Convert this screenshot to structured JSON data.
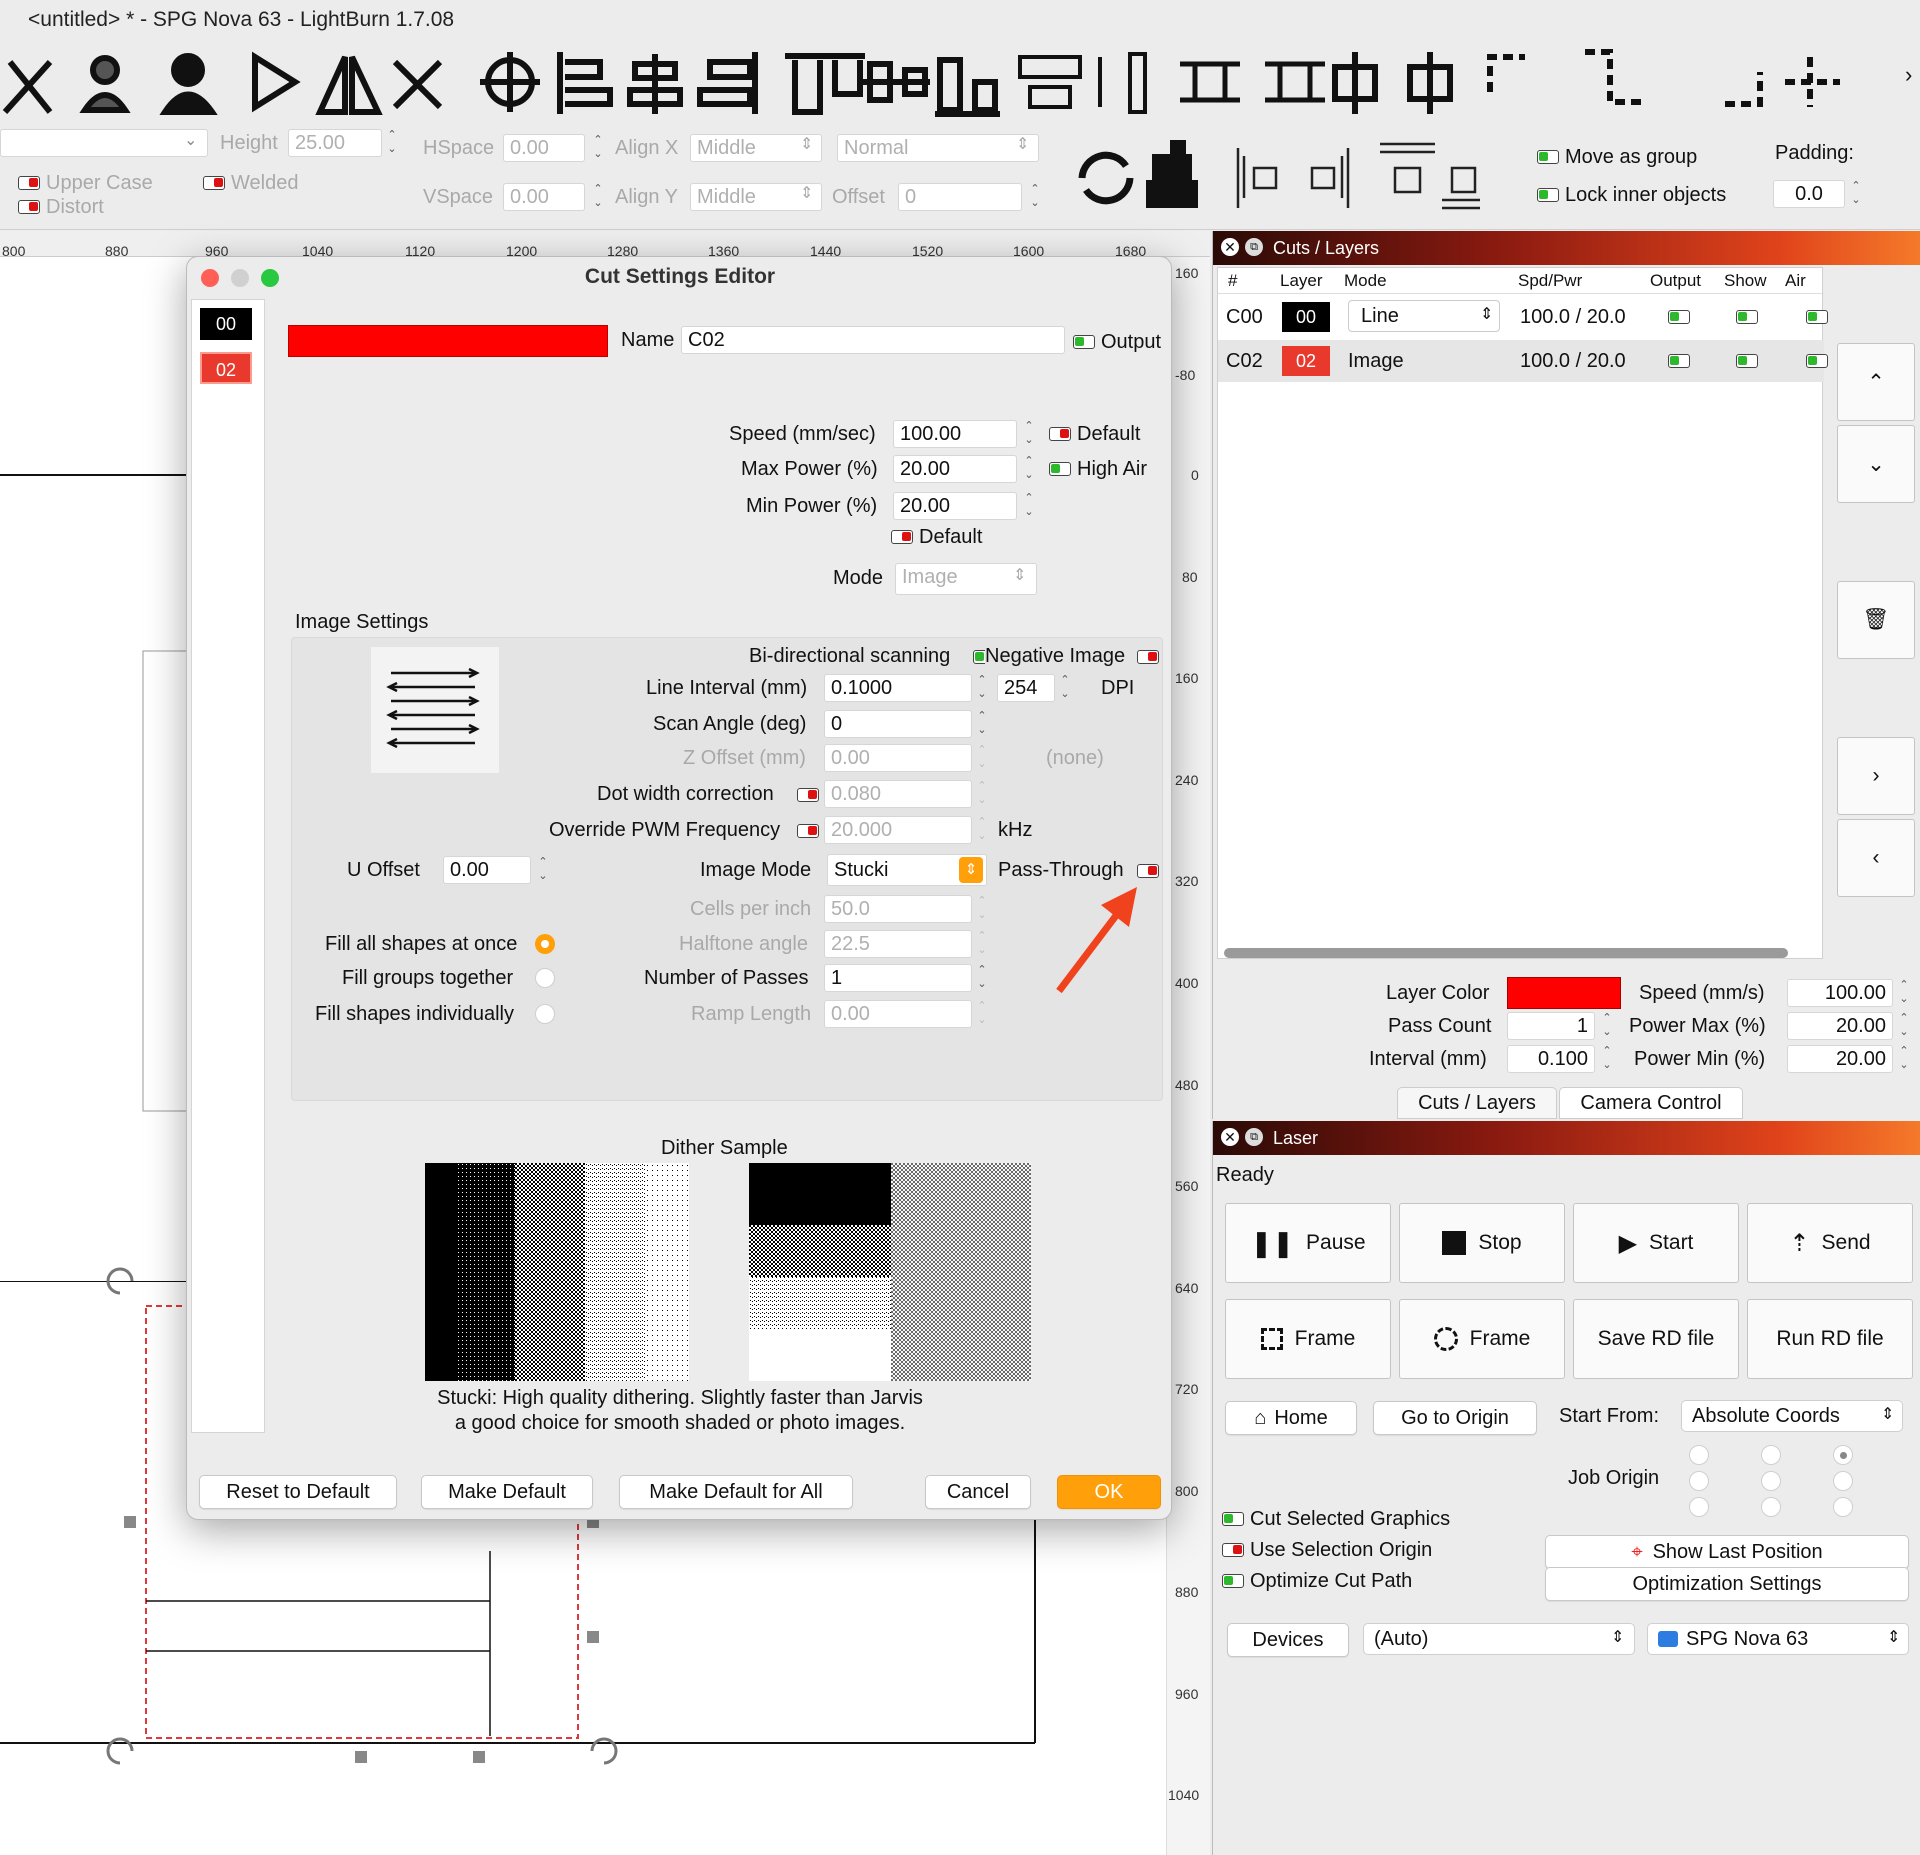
{
  "window": {
    "title": "<untitled> * - SPG Nova 63 - LightBurn 1.7.08"
  },
  "textbar": {
    "height_label": "Height",
    "height_value": "25.00",
    "hspace_label": "HSpace",
    "hspace_value": "0.00",
    "vspace_label": "VSpace",
    "vspace_value": "0.00",
    "alignx_label": "Align X",
    "alignx_value": "Middle",
    "aligny_label": "Align Y",
    "aligny_value": "Middle",
    "mode_value": "Normal",
    "offset_label": "Offset",
    "offset_value": "0",
    "upper_case": "Upper Case",
    "welded": "Welded",
    "distort": "Distort",
    "move_group": "Move as group",
    "lock_inner": "Lock inner objects",
    "padding_label": "Padding:",
    "padding_value": "0.0"
  },
  "rulers": {
    "top": [
      "800",
      "880",
      "960",
      "1040",
      "1120",
      "1200",
      "1280",
      "1360",
      "1440",
      "1520",
      "1600",
      "1680"
    ],
    "right": [
      "160",
      "-80",
      "0",
      "80",
      "160",
      "240",
      "320",
      "400",
      "480",
      "560",
      "640",
      "720",
      "800",
      "880",
      "960",
      "1040"
    ]
  },
  "dialog": {
    "title": "Cut Settings Editor",
    "layers": [
      "00",
      "02"
    ],
    "name_label": "Name",
    "name_value": "C02",
    "output_label": "Output",
    "speed_label": "Speed (mm/sec)",
    "speed_value": "100.00",
    "default_label": "Default",
    "maxpower_label": "Max Power (%)",
    "maxpower_value": "20.00",
    "highair_label": "High Air",
    "minpower_label": "Min Power (%)",
    "minpower_value": "20.00",
    "default2_label": "Default",
    "mode_label": "Mode",
    "mode_value": "Image",
    "image_settings_label": "Image Settings",
    "bidir_label": "Bi-directional scanning",
    "negative_label": "Negative Image",
    "line_interval_label": "Line Interval (mm)",
    "line_interval_value": "0.1000",
    "dpi_value": "254",
    "dpi_label": "DPI",
    "scan_angle_label": "Scan Angle (deg)",
    "scan_angle_value": "0",
    "zoffset_label": "Z Offset (mm)",
    "zoffset_value": "0.00",
    "none_label": "(none)",
    "dotwidth_label": "Dot width correction",
    "dotwidth_value": "0.080",
    "pwm_label": "Override PWM Frequency",
    "pwm_value": "20.000",
    "khz_label": "kHz",
    "uoffset_label": "U Offset",
    "uoffset_value": "0.00",
    "imagemode_label": "Image Mode",
    "imagemode_value": "Stucki",
    "passthrough_label": "Pass-Through",
    "cells_label": "Cells per inch",
    "cells_value": "50.0",
    "halftone_label": "Halftone angle",
    "halftone_value": "22.5",
    "passes_label": "Number of Passes",
    "passes_value": "1",
    "ramp_label": "Ramp Length",
    "ramp_value": "0.00",
    "fill_all": "Fill all shapes at once",
    "fill_groups": "Fill groups together",
    "fill_indiv": "Fill shapes individually",
    "dither_label": "Dither Sample",
    "desc1": "Stucki: High quality dithering. Slightly faster than Jarvis",
    "desc2": "a good choice for smooth shaded or photo images.",
    "btn_reset": "Reset to Default",
    "btn_make": "Make Default",
    "btn_make_all": "Make Default for All",
    "btn_cancel": "Cancel",
    "btn_ok": "OK"
  },
  "cuts": {
    "panel_title": "Cuts / Layers",
    "headers": [
      "#",
      "Layer",
      "Mode",
      "Spd/Pwr",
      "Output",
      "Show",
      "Air"
    ],
    "rows": [
      {
        "num": "C00",
        "layer": "00",
        "mode": "Line",
        "spdpwr": "100.0 / 20.0",
        "color": "#000000"
      },
      {
        "num": "C02",
        "layer": "02",
        "mode": "Image",
        "spdpwr": "100.0 / 20.0",
        "color": "#e8392c"
      }
    ],
    "layer_color_label": "Layer Color",
    "speed_label": "Speed (mm/s)",
    "speed_value": "100.00",
    "pass_label": "Pass Count",
    "pass_value": "1",
    "powermax_label": "Power Max (%)",
    "powermax_value": "20.00",
    "interval_label": "Interval (mm)",
    "interval_value": "0.100",
    "powermin_label": "Power Min (%)",
    "powermin_value": "20.00",
    "tab1": "Cuts / Layers",
    "tab2": "Camera Control"
  },
  "laser": {
    "panel_title": "Laser",
    "status": "Ready",
    "pause": "Pause",
    "stop": "Stop",
    "start": "Start",
    "send": "Send",
    "frame1": "Frame",
    "frame2": "Frame",
    "save_rd": "Save RD file",
    "run_rd": "Run RD file",
    "home": "Home",
    "go_origin": "Go to Origin",
    "start_from_label": "Start From:",
    "start_from_value": "Absolute Coords",
    "job_origin_label": "Job Origin",
    "cut_selected": "Cut Selected Graphics",
    "use_selection": "Use Selection Origin",
    "optimize": "Optimize Cut Path",
    "show_last": "Show Last Position",
    "opt_settings": "Optimization Settings",
    "devices": "Devices",
    "auto_value": "(Auto)",
    "device_value": "SPG Nova 63"
  },
  "colors": {
    "accent": "#ff9f0a",
    "layer_red": "#ff0000",
    "panel_header": "#c83c1a"
  }
}
